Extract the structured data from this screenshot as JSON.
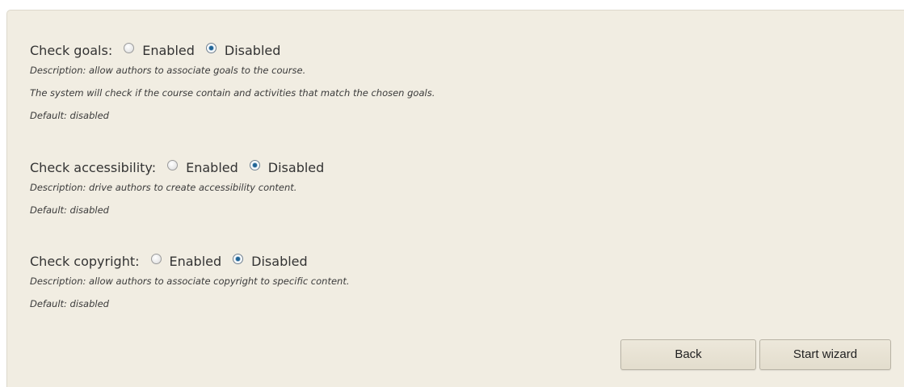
{
  "settings": [
    {
      "label": "Check goals:",
      "options": {
        "enabled": "Enabled",
        "disabled": "Disabled"
      },
      "selected": "Disabled",
      "descriptions": [
        "Description: allow authors to associate goals to the course.",
        "The system will check if the course contain and activities that match the chosen goals.",
        "Default: disabled"
      ]
    },
    {
      "label": "Check accessibility:",
      "options": {
        "enabled": "Enabled",
        "disabled": "Disabled"
      },
      "selected": "Disabled",
      "descriptions": [
        "Description: drive authors to create accessibility content.",
        "Default: disabled"
      ]
    },
    {
      "label": "Check copyright:",
      "options": {
        "enabled": "Enabled",
        "disabled": "Disabled"
      },
      "selected": "Disabled",
      "descriptions": [
        "Description: allow authors to associate copyright to specific content.",
        "Default: disabled"
      ]
    }
  ],
  "buttons": {
    "back": "Back",
    "start_wizard": "Start wizard"
  },
  "colors": {
    "panel_background": "#f1ede2",
    "radio_selected": "#1b5d8c"
  }
}
